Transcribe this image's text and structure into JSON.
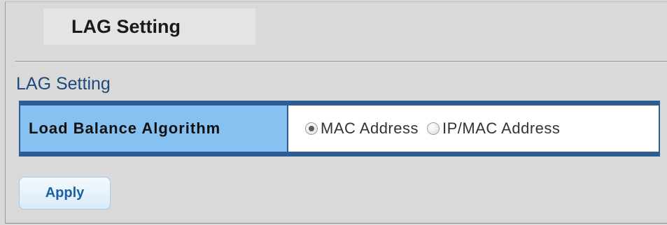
{
  "page": {
    "tab_title": "LAG Setting",
    "section_title": "LAG Setting"
  },
  "setting": {
    "label": "Load Balance Algorithm",
    "options": [
      {
        "label": "MAC Address",
        "checked": true
      },
      {
        "label": "IP/MAC Address",
        "checked": false
      }
    ]
  },
  "actions": {
    "apply_label": "Apply"
  },
  "colors": {
    "table_border": "#2c5e94",
    "label_cell": "#86c1f1",
    "section_title": "#1d4a7a",
    "apply_text": "#1d5fa3"
  }
}
